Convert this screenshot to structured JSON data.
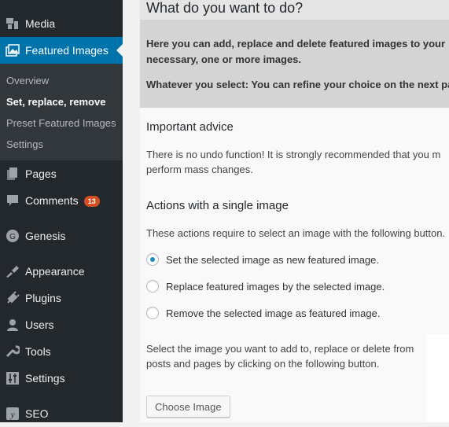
{
  "sidebar": {
    "items": [
      {
        "label": "Media",
        "icon": "media-icon"
      },
      {
        "label": "Featured Images",
        "icon": "featured-images-icon",
        "active": true
      },
      {
        "label": "Pages",
        "icon": "pages-icon"
      },
      {
        "label": "Comments",
        "icon": "comments-icon",
        "badge": "13"
      },
      {
        "label": "Genesis",
        "icon": "genesis-icon"
      },
      {
        "label": "Appearance",
        "icon": "appearance-icon"
      },
      {
        "label": "Plugins",
        "icon": "plugins-icon"
      },
      {
        "label": "Users",
        "icon": "users-icon"
      },
      {
        "label": "Tools",
        "icon": "tools-icon"
      },
      {
        "label": "Settings",
        "icon": "settings-icon"
      },
      {
        "label": "SEO",
        "icon": "seo-icon"
      }
    ],
    "submenu": [
      {
        "label": "Overview"
      },
      {
        "label": "Set, replace, remove",
        "current": true
      },
      {
        "label": "Preset Featured Images"
      },
      {
        "label": "Settings"
      }
    ]
  },
  "main": {
    "title": "What do you want to do?",
    "intro_p1_l1": "Here you can add, replace and delete featured images to your",
    "intro_p1_l2": "necessary, one or more images.",
    "intro_p2": "Whatever you select: You can refine your choice on the next pa",
    "advice_heading": "Important advice",
    "advice_l1": "There is no undo function! It is strongly recommended that you m",
    "advice_l2": "perform mass changes.",
    "single_heading": "Actions with a single image",
    "single_desc": "These actions require to select an image with the following button.",
    "options": [
      {
        "label": "Set the selected image as new featured image.",
        "checked": true
      },
      {
        "label": "Replace featured images by the selected image.",
        "checked": false
      },
      {
        "label": "Remove the selected image as featured image.",
        "checked": false
      }
    ],
    "select_l1": "Select the image you want to add to, replace or delete from",
    "select_l2": "posts and pages by clicking on the following button.",
    "choose_button": "Choose Image"
  },
  "colors": {
    "accent": "#0073aa",
    "badge": "#d54e21",
    "sidebar": "#23282d"
  }
}
